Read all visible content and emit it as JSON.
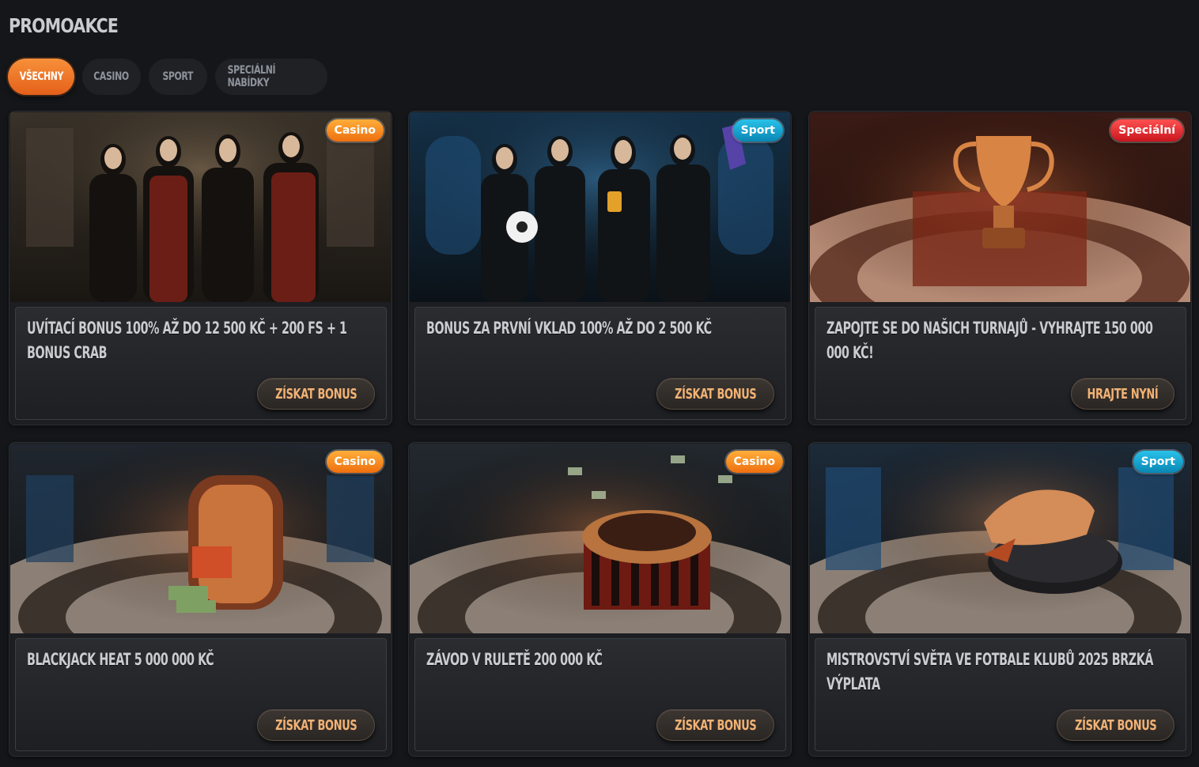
{
  "page": {
    "title": "PROMOAKCE"
  },
  "tabs": [
    {
      "label": "VŠECHNY",
      "active": true
    },
    {
      "label": "CASINO",
      "active": false
    },
    {
      "label": "SPORT",
      "active": false
    },
    {
      "label": "SPECIÁLNÍ NABÍDKY",
      "active": false
    }
  ],
  "colors": {
    "accent": "#f07a25",
    "casino_badge": "#ee6f0f",
    "sport_badge": "#0a86b3",
    "special_badge": "#c8151d",
    "cta_text": "#f2b274",
    "background": "#141619"
  },
  "promos": [
    {
      "badge": "Casino",
      "title": "UVÍTACÍ BONUS 100% AŽ DO 12 500 KČ + 200 FS + 1 BONUS CRAB",
      "cta": "ZÍSKAT BONUS"
    },
    {
      "badge": "Sport",
      "title": "BONUS ZA PRVNÍ VKLAD 100% AŽ DO 2 500 KČ",
      "cta": "ZÍSKAT BONUS"
    },
    {
      "badge": "Speciální",
      "title": "ZAPOJTE SE DO NAŠICH TURNAJŮ - VYHRAJTE 150 000 000 KČ!",
      "cta": "HRAJTE NYNÍ"
    },
    {
      "badge": "Casino",
      "title": "BLACKJACK HEAT 5 000 000 KČ",
      "cta": "ZÍSKAT BONUS"
    },
    {
      "badge": "Casino",
      "title": "ZÁVOD V RULETĚ 200 000 KČ",
      "cta": "ZÍSKAT BONUS"
    },
    {
      "badge": "Sport",
      "title": "MISTROVSTVÍ SVĚTA VE FOTBALE KLUBŮ 2025 BRZKÁ VÝPLATA",
      "cta": "ZÍSKAT BONUS"
    }
  ]
}
